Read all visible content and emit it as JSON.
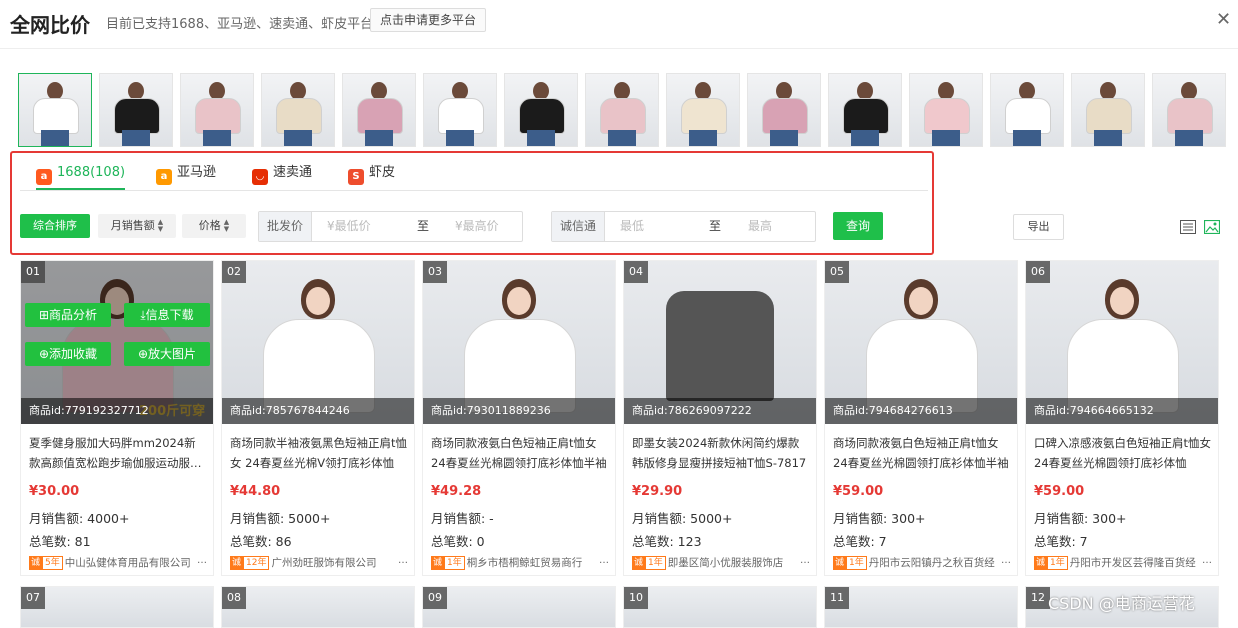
{
  "header": {
    "title": "全网比价",
    "subtitle": "目前已支持1688、亚马逊、速卖通、虾皮平台",
    "apply_button": "点击申请更多平台"
  },
  "colors": {
    "accent": "#1fbf4a",
    "price": "#e53935",
    "highlight": "#e53935"
  },
  "thumbnails": [
    {
      "shirt": "#ffffff"
    },
    {
      "shirt": "#1b1b1b"
    },
    {
      "shirt": "#e9c3c8"
    },
    {
      "shirt": "#e8dcc6"
    },
    {
      "shirt": "#d8a2b4"
    },
    {
      "shirt": "#ffffff"
    },
    {
      "shirt": "#1b1b1b"
    },
    {
      "shirt": "#e9c3c8"
    },
    {
      "shirt": "#efe4d0"
    },
    {
      "shirt": "#d8a2b4"
    },
    {
      "shirt": "#1b1b1b"
    },
    {
      "shirt": "#f0c8cc"
    },
    {
      "shirt": "#ffffff"
    },
    {
      "shirt": "#e8dcc6"
    },
    {
      "shirt": "#e9c3c8"
    }
  ],
  "platform_tabs": [
    {
      "label": "1688(108)",
      "icon": "1688-icon",
      "active": true
    },
    {
      "label": "亚马逊",
      "icon": "amazon-icon",
      "active": false
    },
    {
      "label": "速卖通",
      "icon": "aliexpress-icon",
      "active": false
    },
    {
      "label": "虾皮",
      "icon": "shopee-icon",
      "active": false
    }
  ],
  "filters": {
    "sort_default": "综合排序",
    "sort_sales": "月销售额",
    "sort_price": "价格",
    "wholesale_label": "批发价",
    "min_price_placeholder": "¥最低价",
    "to": "至",
    "max_price_placeholder": "¥最高价",
    "credit_label": "诚信通",
    "min_placeholder": "最低",
    "max_placeholder": "最高",
    "query_button": "查询",
    "export_button": "导出"
  },
  "hover_actions": {
    "analysis": "商品分析",
    "download": "信息下载",
    "favorite": "添加收藏",
    "zoom": "放大图片",
    "promo": "200斤可穿"
  },
  "products": [
    {
      "idx": "01",
      "id": "商品id:779192327712",
      "title": "夏季健身服加大码胖mm2024新款高颜值宽松跑步瑜伽服运动服…",
      "price": "¥30.00",
      "sales": "月销售额: 4000+",
      "total": "总笔数: 81",
      "cx": "诚",
      "years": "5年",
      "shop": "中山弘健体育用品有限公司",
      "shirt": "#f2c7cf"
    },
    {
      "idx": "02",
      "id": "商品id:785767844246",
      "title": "商场同款半袖液氨黑色短袖正肩t恤女 24春夏丝光棉V领打底衫体恤",
      "price": "¥44.80",
      "sales": "月销售额: 5000+",
      "total": "总笔数: 86",
      "cx": "诚",
      "years": "12年",
      "shop": "广州劲旺服饰有限公司",
      "shirt": "#ffffff"
    },
    {
      "idx": "03",
      "id": "商品id:793011889236",
      "title": "商场同款液氨白色短袖正肩t恤女24春夏丝光棉圆领打底衫体恤半袖",
      "price": "¥49.28",
      "sales": "月销售额: -",
      "total": "总笔数: 0",
      "cx": "诚",
      "years": "1年",
      "shop": "桐乡市梧桐鲸虹贸易商行",
      "shirt": "#ffffff"
    },
    {
      "idx": "04",
      "id": "商品id:786269097222",
      "title": "即墨女装2024新款休闲简约爆款韩版修身显瘦拼接短袖T恤S-7817",
      "price": "¥29.90",
      "sales": "月销售额: 5000+",
      "total": "总笔数: 123",
      "cx": "诚",
      "years": "1年",
      "shop": "即墨区简小优服装服饰店",
      "shirt": "#555555"
    },
    {
      "idx": "05",
      "id": "商品id:794684276613",
      "title": "商场同款液氨白色短袖正肩t恤女24春夏丝光棉圆领打底衫体恤半袖",
      "price": "¥59.00",
      "sales": "月销售额: 300+",
      "total": "总笔数: 7",
      "cx": "诚",
      "years": "1年",
      "shop": "丹阳市云阳镇丹之秋百货经",
      "shirt": "#ffffff"
    },
    {
      "idx": "06",
      "id": "商品id:794664665132",
      "title": "口碑入凉感液氨白色短袖正肩t恤女24春夏丝光棉圆领打底衫体恤",
      "price": "¥59.00",
      "sales": "月销售额: 300+",
      "total": "总笔数: 7",
      "cx": "诚",
      "years": "1年",
      "shop": "丹阳市开发区芸得隆百货经",
      "shirt": "#ffffff"
    }
  ],
  "next_row": [
    "07",
    "08",
    "09",
    "10",
    "11",
    "12"
  ],
  "watermark": "CSDN @电商运营花"
}
